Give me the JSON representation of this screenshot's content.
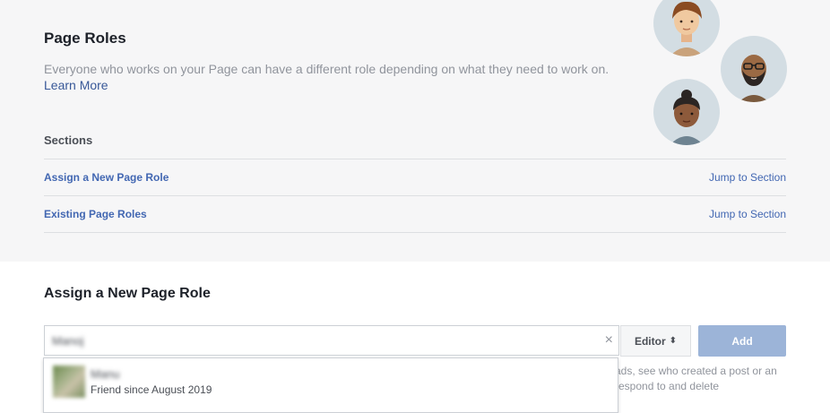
{
  "page_roles": {
    "title": "Page Roles",
    "description": "Everyone who works on your Page can have a different role depending on what they need to work on.",
    "learn_more": "Learn More"
  },
  "sections": {
    "title": "Sections",
    "items": [
      {
        "label": "Assign a New Page Role",
        "jump": "Jump to Section"
      },
      {
        "label": "Existing Page Roles",
        "jump": "Jump to Section"
      }
    ]
  },
  "assign": {
    "title": "Assign a New Page Role",
    "search_value": "Manoj",
    "clear_icon": "×",
    "role_value": "Editor",
    "role_arrow": "⬍",
    "add_label": "Add",
    "help_text": "ads, see who created a post or an respond to and delete"
  },
  "suggestion": {
    "name": "Manu",
    "subtitle": "Friend since August 2019"
  },
  "colors": {
    "link": "#4267b2",
    "add_button_disabled": "#9cb4d8",
    "panel_bg": "#f6f6f7"
  }
}
